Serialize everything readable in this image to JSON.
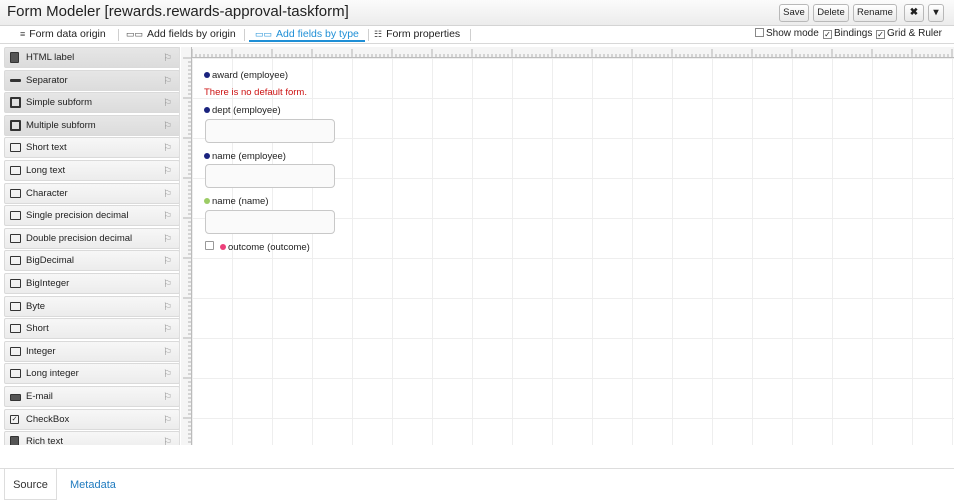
{
  "window": {
    "title": "Form Modeler [rewards.rewards-approval-taskform]",
    "buttons": {
      "save": "Save",
      "delete": "Delete",
      "rename": "Rename",
      "close": "✖",
      "more": "▾"
    }
  },
  "toolbar": {
    "tabs": [
      {
        "label": "Form data origin",
        "icon": "≡"
      },
      {
        "label": "Add fields by origin",
        "icon": "▭▭"
      },
      {
        "label": "Add fields by type",
        "icon": "▭▭"
      },
      {
        "label": "Form properties",
        "icon": "☷"
      }
    ],
    "active_tab": "Add fields by type",
    "options": {
      "show_mode": {
        "label": "Show mode",
        "checked": false
      },
      "bindings": {
        "label": "Bindings",
        "checked": true
      },
      "grid_ruler": {
        "label": "Grid & Ruler",
        "checked": true
      }
    }
  },
  "palette": {
    "items": [
      {
        "label": "HTML label",
        "icon": "html-label-icon"
      },
      {
        "label": "Separator",
        "icon": "separator-icon"
      },
      {
        "label": "Simple subform",
        "icon": "subform-icon"
      },
      {
        "label": "Multiple subform",
        "icon": "subform-icon"
      },
      {
        "label": "Short text",
        "icon": "textbox-icon"
      },
      {
        "label": "Long text",
        "icon": "textbox-icon"
      },
      {
        "label": "Character",
        "icon": "textbox-icon"
      },
      {
        "label": "Single precision decimal",
        "icon": "textbox-icon"
      },
      {
        "label": "Double precision decimal",
        "icon": "textbox-icon"
      },
      {
        "label": "BigDecimal",
        "icon": "textbox-icon"
      },
      {
        "label": "BigInteger",
        "icon": "textbox-icon"
      },
      {
        "label": "Byte",
        "icon": "textbox-icon"
      },
      {
        "label": "Short",
        "icon": "textbox-icon"
      },
      {
        "label": "Integer",
        "icon": "textbox-icon"
      },
      {
        "label": "Long integer",
        "icon": "textbox-icon"
      },
      {
        "label": "E-mail",
        "icon": "email-icon"
      },
      {
        "label": "CheckBox",
        "icon": "checkbox-icon"
      },
      {
        "label": "Rich text",
        "icon": "rich-text-icon"
      }
    ]
  },
  "form": {
    "fields": [
      {
        "label": "award (employee)",
        "dot_color": "#1a237e"
      },
      {
        "label": "dept (employee)",
        "dot_color": "#1a237e"
      },
      {
        "label": "name (employee)",
        "dot_color": "#1a237e"
      },
      {
        "label": "name (name)",
        "dot_color": "#9ccc65"
      },
      {
        "label": "outcome (outcome)",
        "dot_color": "#ec407a"
      }
    ],
    "no_default_message": "There is no default form."
  },
  "bottom_tabs": {
    "source": "Source",
    "metadata": "Metadata"
  },
  "colors": {
    "accent": "#1f8fd6",
    "error": "#cc1111"
  }
}
